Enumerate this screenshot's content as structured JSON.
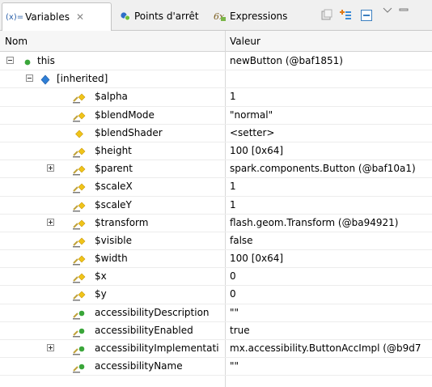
{
  "tabs": [
    {
      "label": "Variables",
      "icon": "variables-icon",
      "active": true
    },
    {
      "label": "Points d'arrêt",
      "icon": "breakpoints-icon",
      "active": false
    },
    {
      "label": "Expressions",
      "icon": "expressions-icon",
      "active": false
    }
  ],
  "variables_prefix": "(x)=",
  "columns": {
    "name": "Nom",
    "value": "Valeur"
  },
  "rows": [
    {
      "name": "this",
      "value": "newButton (@baf1851)",
      "icon": "object-green-dot-icon",
      "expander": "minus",
      "indent": 0
    },
    {
      "name": "[inherited]",
      "value": "",
      "icon": "inherited-diamond-icon",
      "expander": "minus",
      "indent": 1
    },
    {
      "name": "$alpha",
      "value": "1",
      "icon": "setter-pencil-diamond-icon",
      "expander": "",
      "indent": 2
    },
    {
      "name": "$blendMode",
      "value": "\"normal\"",
      "icon": "setter-pencil-diamond-icon",
      "expander": "",
      "indent": 2
    },
    {
      "name": "$blendShader",
      "value": "<setter>",
      "icon": "diamond-icon",
      "expander": "",
      "indent": 2
    },
    {
      "name": "$height",
      "value": "100 [0x64]",
      "icon": "setter-pencil-diamond-icon",
      "expander": "",
      "indent": 2
    },
    {
      "name": "$parent",
      "value": "spark.components.Button (@baf10a1)",
      "icon": "setter-pencil-diamond-icon",
      "expander": "plus",
      "indent": 2
    },
    {
      "name": "$scaleX",
      "value": "1",
      "icon": "setter-pencil-diamond-icon",
      "expander": "",
      "indent": 2
    },
    {
      "name": "$scaleY",
      "value": "1",
      "icon": "setter-pencil-diamond-icon",
      "expander": "",
      "indent": 2
    },
    {
      "name": "$transform",
      "value": "flash.geom.Transform (@ba94921)",
      "icon": "setter-pencil-diamond-icon",
      "expander": "plus",
      "indent": 2
    },
    {
      "name": "$visible",
      "value": "false",
      "icon": "setter-pencil-diamond-icon",
      "expander": "",
      "indent": 2
    },
    {
      "name": "$width",
      "value": "100 [0x64]",
      "icon": "setter-pencil-diamond-icon",
      "expander": "",
      "indent": 2
    },
    {
      "name": "$x",
      "value": "0",
      "icon": "setter-pencil-diamond-icon",
      "expander": "",
      "indent": 2
    },
    {
      "name": "$y",
      "value": "0",
      "icon": "setter-pencil-diamond-icon",
      "expander": "",
      "indent": 2
    },
    {
      "name": "accessibilityDescription",
      "value": "\"\"",
      "icon": "setter-pencil-dot-icon",
      "expander": "",
      "indent": 2
    },
    {
      "name": "accessibilityEnabled",
      "value": "true",
      "icon": "setter-pencil-dot-icon",
      "expander": "",
      "indent": 2
    },
    {
      "name": "accessibilityImplementati",
      "value": "mx.accessibility.ButtonAccImpl (@b9d7",
      "icon": "setter-pencil-dot-icon",
      "expander": "plus",
      "indent": 2
    },
    {
      "name": "accessibilityName",
      "value": "\"\"",
      "icon": "setter-pencil-dot-icon",
      "expander": "",
      "indent": 2
    }
  ],
  "colors": {
    "green": "#3aa63a",
    "blue_diamond": "#2f7fd6",
    "yellow_diamond": "#f0c419"
  }
}
